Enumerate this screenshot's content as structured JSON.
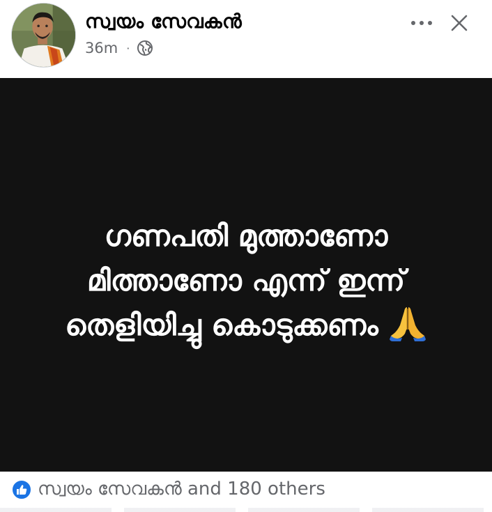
{
  "post": {
    "author": "സ്വയം സേവകൻ",
    "time": "36m",
    "separator": "·",
    "privacy_icon": "globe-icon",
    "lines": [
      "ഗണപതി മുത്താണോ",
      "മിത്താണോ എന്ന് ഇന്ന്",
      "തെളിയിച്ചു കൊടുക്കണം"
    ],
    "emoji": "folded-hands-emoji"
  },
  "reactions": {
    "icon": "like-icon",
    "text": "സ്വയം സേവകൻ and 180 others"
  },
  "colors": {
    "image_background": "#121212",
    "like_blue": "#1b74e4",
    "meta_gray": "#65676b",
    "name_black": "#050505"
  }
}
